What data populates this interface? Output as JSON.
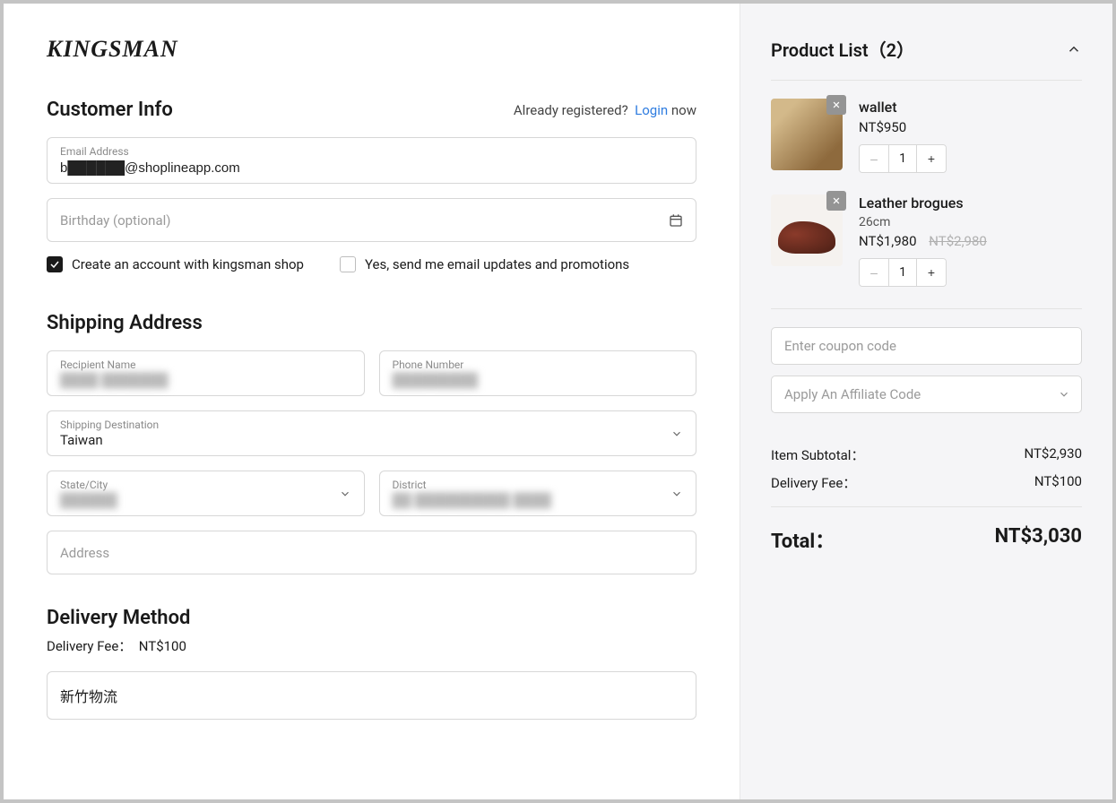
{
  "logo": "KINGSMAN",
  "customer": {
    "heading": "Customer Info",
    "already": "Already registered?",
    "login": "Login",
    "now": "now",
    "email_label": "Email Address",
    "email_value": "b██████@shoplineapp.com",
    "birthday_placeholder": "Birthday (optional)",
    "create_account": "Create an account with kingsman shop",
    "email_updates": "Yes, send me email updates and promotions"
  },
  "shipping": {
    "heading": "Shipping Address",
    "recipient_label": "Recipient Name",
    "recipient_value": "████ ███████",
    "phone_label": "Phone Number",
    "phone_value": "█████████",
    "destination_label": "Shipping Destination",
    "destination_value": "Taiwan",
    "state_label": "State/City",
    "state_value": "██████",
    "district_label": "District",
    "district_value": "██ ██████████ ████",
    "address_placeholder": "Address"
  },
  "delivery": {
    "heading": "Delivery Method",
    "fee_label": "Delivery Fee：",
    "fee_value": "NT$100",
    "option": "新竹物流"
  },
  "cart": {
    "header_prefix": "Product List（",
    "count": "2",
    "header_suffix": "）",
    "items": [
      {
        "name": "wallet",
        "variant": "",
        "price": "NT$950",
        "old_price": "",
        "qty": "1"
      },
      {
        "name": "Leather brogues",
        "variant": "26cm",
        "price": "NT$1,980",
        "old_price": "NT$2,980",
        "qty": "1"
      }
    ],
    "coupon_placeholder": "Enter coupon code",
    "affiliate_placeholder": "Apply An Affiliate Code",
    "subtotal_label": "Item Subtotal：",
    "subtotal_value": "NT$2,930",
    "delivery_label": "Delivery Fee：",
    "delivery_value": "NT$100",
    "total_label": "Total：",
    "total_value": "NT$3,030"
  }
}
